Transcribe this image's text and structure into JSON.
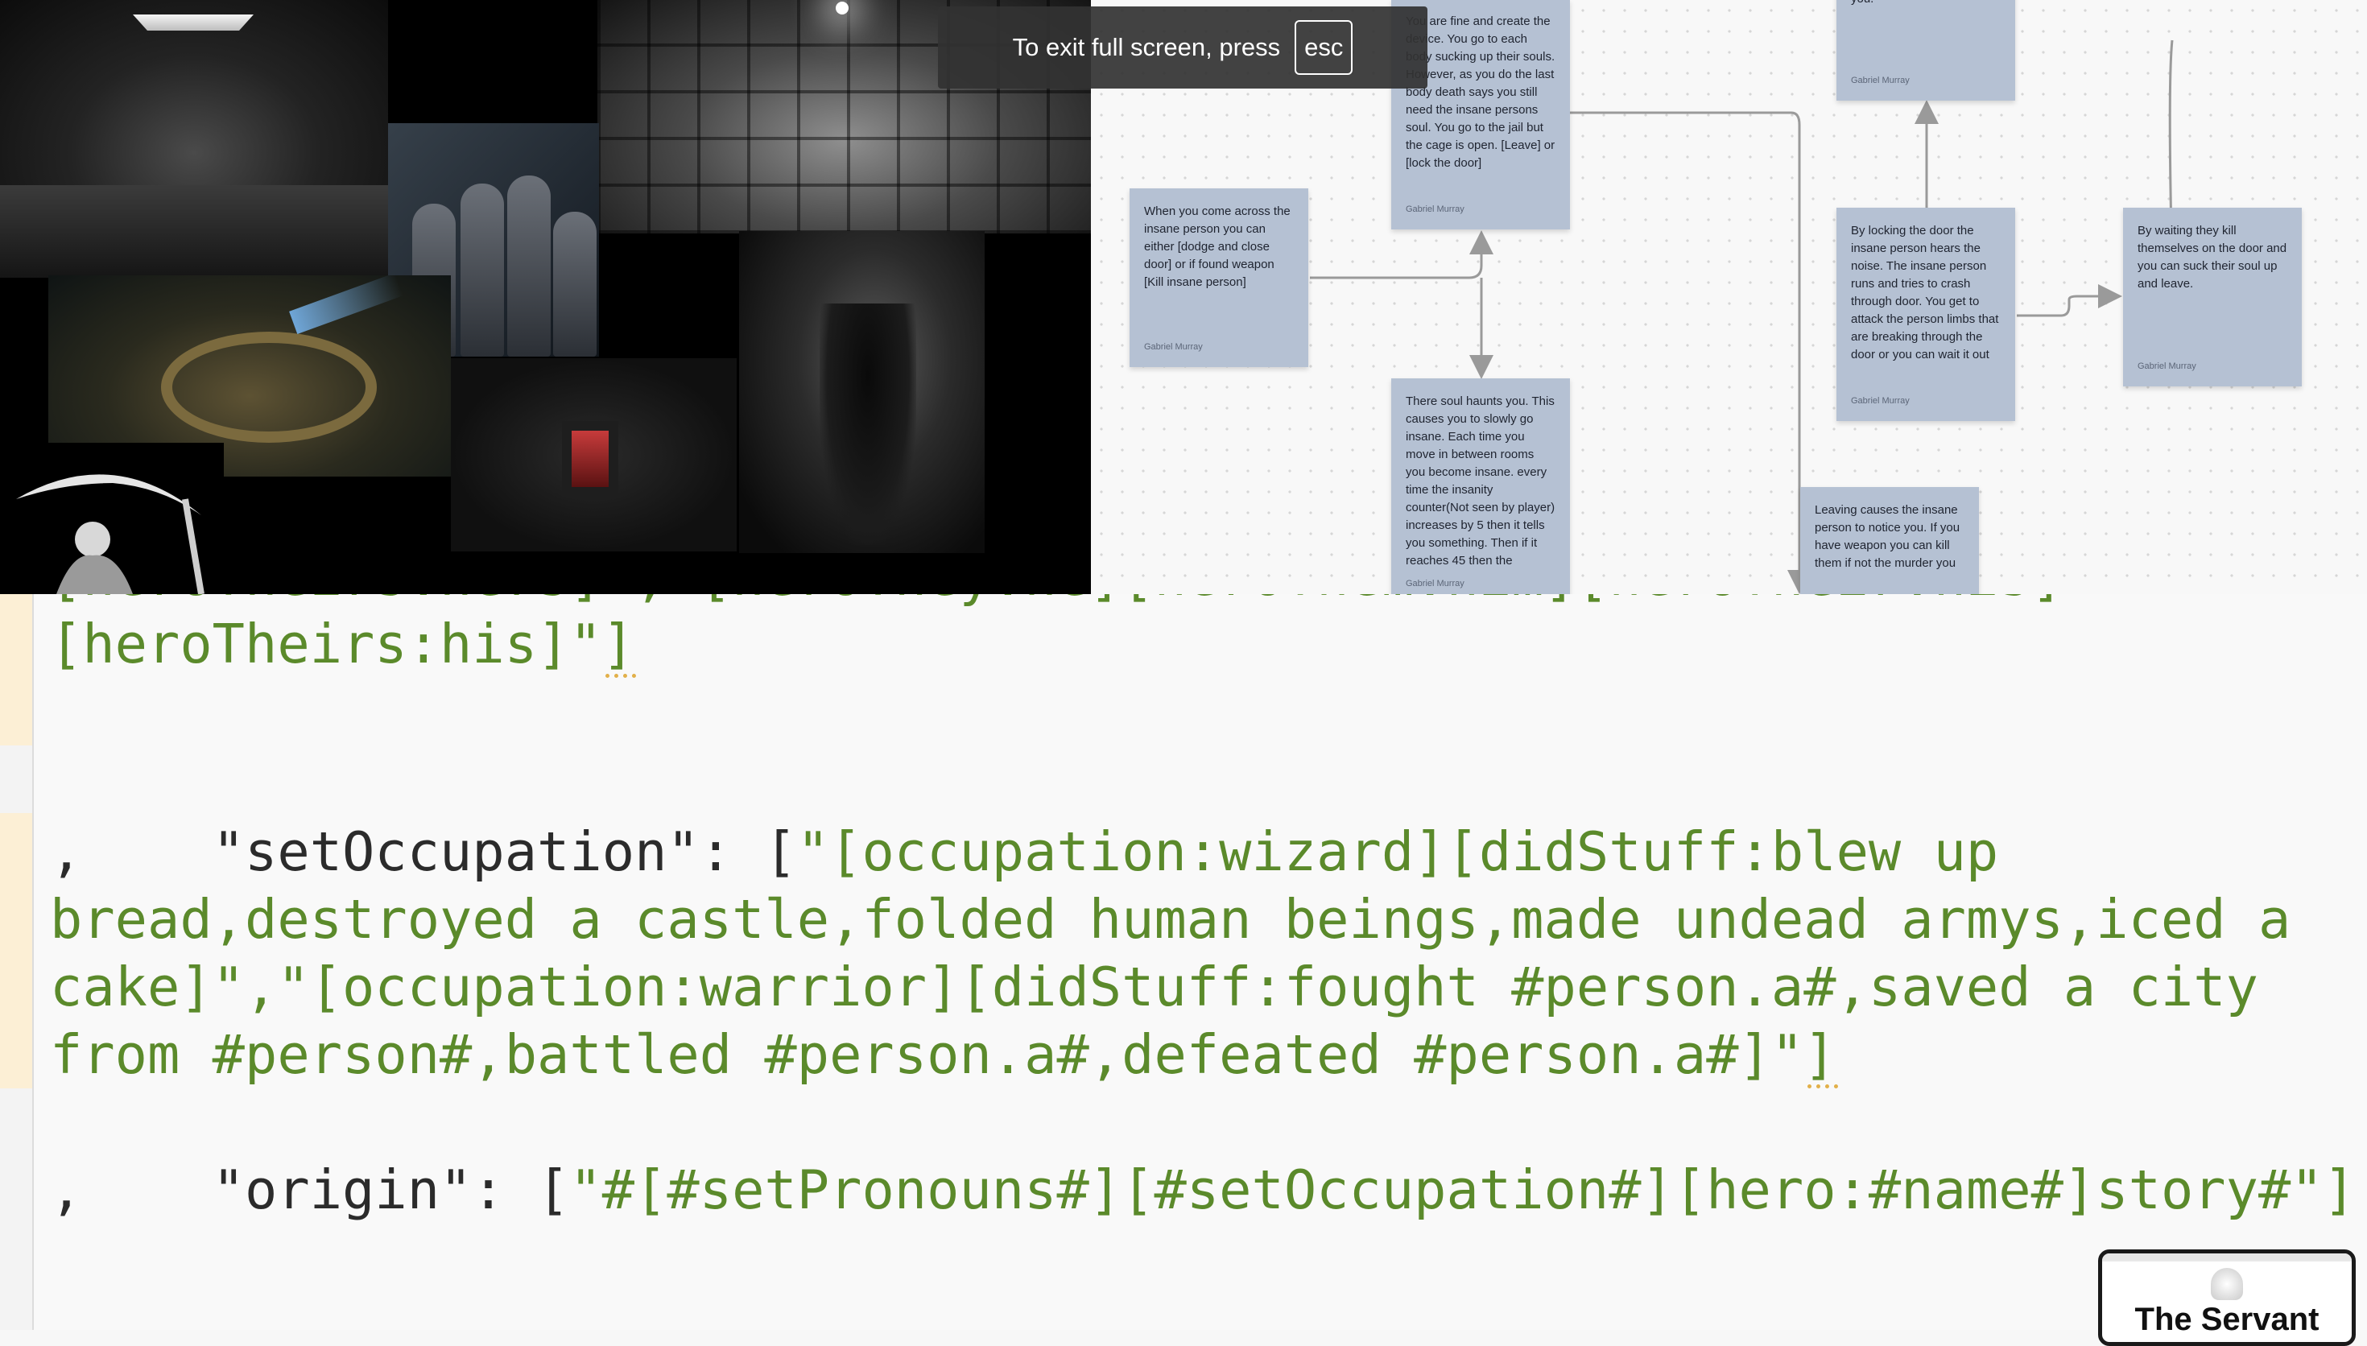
{
  "editor": {
    "lines": [
      {
        "text": "[heroTheirs:hers]\",\"[heroThey:he][heroThem:him][heroTheir:his]"
      },
      {
        "text": "[heroTheirs:his]\"]"
      },
      {
        "prefix": ",    ",
        "key": "\"setOccupation\"",
        "sep": ": [",
        "text": "\"[occupation:wizard][didStuff:blew up"
      },
      {
        "text": "bread,destroyed a castle,folded human beings,made undead armys,iced a"
      },
      {
        "text": "cake]\",\"[occupation:warrior][didStuff:fought #person.a#,saved a city"
      },
      {
        "text": "from #person#,battled #person.a#,defeated #person.a#]\"]"
      },
      {
        "prefix": ",    ",
        "key": "\"origin\"",
        "sep": ": [",
        "text": "\"#[#setPronouns#][#setOccupation#][hero:#name#]story#\"]"
      }
    ]
  },
  "fullscreen_toast": {
    "message": "To exit full screen, press",
    "key": "esc"
  },
  "board": {
    "notes": [
      {
        "body": "You are fine and create the device. You go to each body sucking up their souls. However, as you do the last body death says you still need the insane persons soul. You go to the jail but the cage is open. [Leave] or [lock the door]",
        "author": "Gabriel Murray"
      },
      {
        "body": "When you come across the insane person you can either [dodge and close door] or if found weapon [Kill insane person]",
        "author": "Gabriel Murray"
      },
      {
        "body": "There soul haunts you. This causes you to slowly go insane. Each time you move in between rooms you become insane. every time the insanity counter(Not seen by player) increases by 5 then it tells you something. Then if it reaches 45 then the",
        "author": "Gabriel Murray"
      },
      {
        "body": "you.",
        "author": "Gabriel Murray"
      },
      {
        "body": "By locking the door the insane person hears the noise. The insane person runs and tries to crash through door. You get to attack the person limbs that are breaking through the door or you can wait it out",
        "author": "Gabriel Murray"
      },
      {
        "body": "By waiting they kill themselves on the door and you can suck their soul up and leave.",
        "author": "Gabriel Murray"
      },
      {
        "body": "Leaving causes the insane person to notice you. If you have weapon you can kill them if not the murder you",
        "author": ""
      }
    ]
  },
  "thumbnail": {
    "title": "The Servant"
  }
}
